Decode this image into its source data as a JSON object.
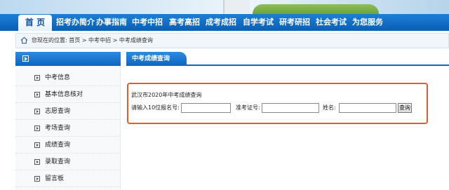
{
  "nav": {
    "items": [
      "首 页",
      "招考办简介",
      "办事指南",
      "中考中招",
      "高考高招",
      "成考成招",
      "自学考试",
      "研考研招",
      "社会考试",
      "为您服务"
    ]
  },
  "breadcrumb": {
    "icon": "home-icon",
    "text": "您现在的位置: 首页 > 中考中招 > 中考成绩查询"
  },
  "sidebar": {
    "items": [
      "中考信息",
      "基本信息核对",
      "志愿查询",
      "考场查询",
      "成绩查询",
      "录取查询",
      "留言板"
    ]
  },
  "main": {
    "tab": "中考成绩查询",
    "form": {
      "title": "武汉市2020年中考成绩查询",
      "reg_label": "请输入10位报名号:",
      "reg_value": "",
      "ticket_label": "准考证号:",
      "ticket_value": "",
      "name_label": "姓名:",
      "name_value": "",
      "submit_label": "查询"
    }
  },
  "colors": {
    "nav_blue": "#0a5fb5",
    "highlight_border": "#e25b2c"
  }
}
